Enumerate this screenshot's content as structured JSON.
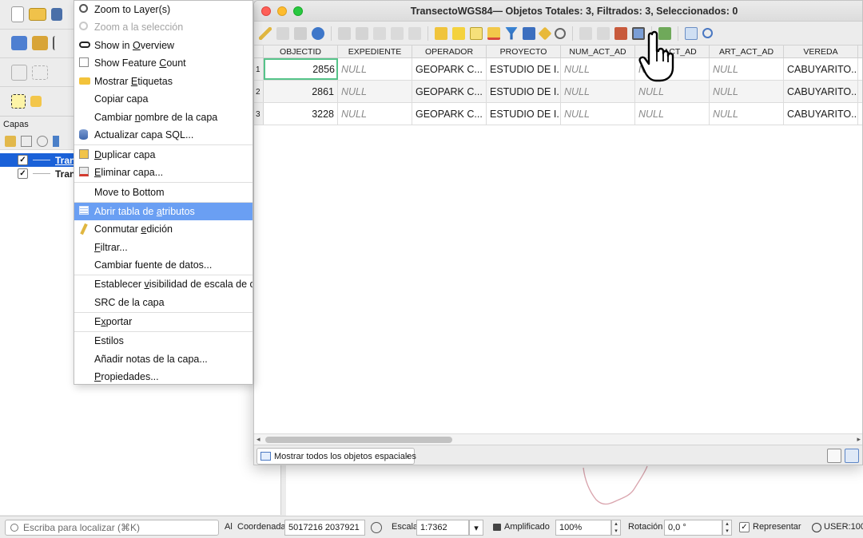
{
  "attribute_window": {
    "title": "TransectoWGS84— Objetos Totales: 3, Filtrados: 3, Seleccionados: 0",
    "columns": [
      "OBJECTID",
      "EXPEDIENTE",
      "OPERADOR",
      "PROYECTO",
      "NUM_ACT_AD",
      "ACT_AD",
      "ART_ACT_AD",
      "VEREDA"
    ],
    "rows": [
      {
        "num": "1",
        "cells": [
          "2856",
          "NULL",
          "GEOPARK C...",
          "ESTUDIO DE I...",
          "NULL",
          "NULL",
          "NULL",
          "CABUYARITO..."
        ]
      },
      {
        "num": "2",
        "cells": [
          "2861",
          "NULL",
          "GEOPARK C...",
          "ESTUDIO DE I...",
          "NULL",
          "NULL",
          "NULL",
          "CABUYARITO..."
        ]
      },
      {
        "num": "3",
        "cells": [
          "3228",
          "NULL",
          "GEOPARK C...",
          "ESTUDIO DE I...",
          "NULL",
          "NULL",
          "NULL",
          "CABUYARITO..."
        ]
      }
    ],
    "filter_button": "Mostrar todos los objetos espaciales"
  },
  "context_menu": {
    "items": [
      {
        "label": "Zoom to Layer(s)",
        "icon": "zoom-layer-icon",
        "disabled": false
      },
      {
        "label": "Zoom a la selección",
        "icon": "zoom-selection-icon",
        "disabled": true
      },
      {
        "label": "Show in Overview",
        "icon": "overview-glasses-icon",
        "disabled": false
      },
      {
        "label": "Show Feature Count",
        "icon": "checkbox-icon",
        "disabled": false
      },
      {
        "label": "Mostrar Etiquetas",
        "icon": "labels-icon",
        "disabled": false
      },
      {
        "label": "Copiar capa",
        "icon": "",
        "disabled": false
      },
      {
        "label": "Cambiar nombre de la capa",
        "icon": "",
        "disabled": false
      },
      {
        "label": "Actualizar capa SQL...",
        "icon": "database-icon",
        "disabled": false
      },
      {
        "label": "Duplicar capa",
        "icon": "duplicate-icon",
        "disabled": false
      },
      {
        "label": "Eliminar capa...",
        "icon": "remove-layer-icon",
        "disabled": false
      },
      {
        "label": "Move to Bottom",
        "icon": "",
        "disabled": false
      },
      {
        "label": "Abrir tabla de atributos",
        "icon": "table-icon",
        "disabled": false,
        "highlighted": true
      },
      {
        "label": "Conmutar edición",
        "icon": "pencil-icon",
        "disabled": false
      },
      {
        "label": "Filtrar...",
        "icon": "",
        "disabled": false
      },
      {
        "label": "Cambiar fuente de datos...",
        "icon": "",
        "disabled": false
      },
      {
        "label": "Establecer visibilidad de escala de c",
        "icon": "",
        "disabled": false
      },
      {
        "label": "SRC de la capa",
        "icon": "",
        "disabled": false
      },
      {
        "label": "Exportar",
        "icon": "",
        "disabled": false
      },
      {
        "label": "Estilos",
        "icon": "",
        "disabled": false
      },
      {
        "label": "Añadir notas de la capa...",
        "icon": "",
        "disabled": false
      },
      {
        "label": "Propiedades...",
        "icon": "",
        "disabled": false
      }
    ]
  },
  "layers_panel": {
    "title": "Capas",
    "layers": [
      {
        "name": "Trans",
        "checked": "✓",
        "selected": true
      },
      {
        "name": "Trans",
        "checked": "✓",
        "selected": false
      }
    ]
  },
  "statusbar": {
    "search_placeholder": "Escriba para localizar (⌘K)",
    "al_label": "Al",
    "coord_label": "Coordenada",
    "coord_value": "5017216 2037921",
    "scale_label": "Escala",
    "scale_value": "1:7362",
    "magnifier_label": "Amplificado",
    "magnifier_value": "100%",
    "rotation_label": "Rotación",
    "rotation_value": "0,0 °",
    "render_label": "Representar",
    "render_checked": "✓",
    "crs_label": "USER:100"
  },
  "colors": {
    "selection_blue": "#1a61d8",
    "menu_highlight": "#6a9ff3",
    "cell_focus": "#56c48a"
  }
}
